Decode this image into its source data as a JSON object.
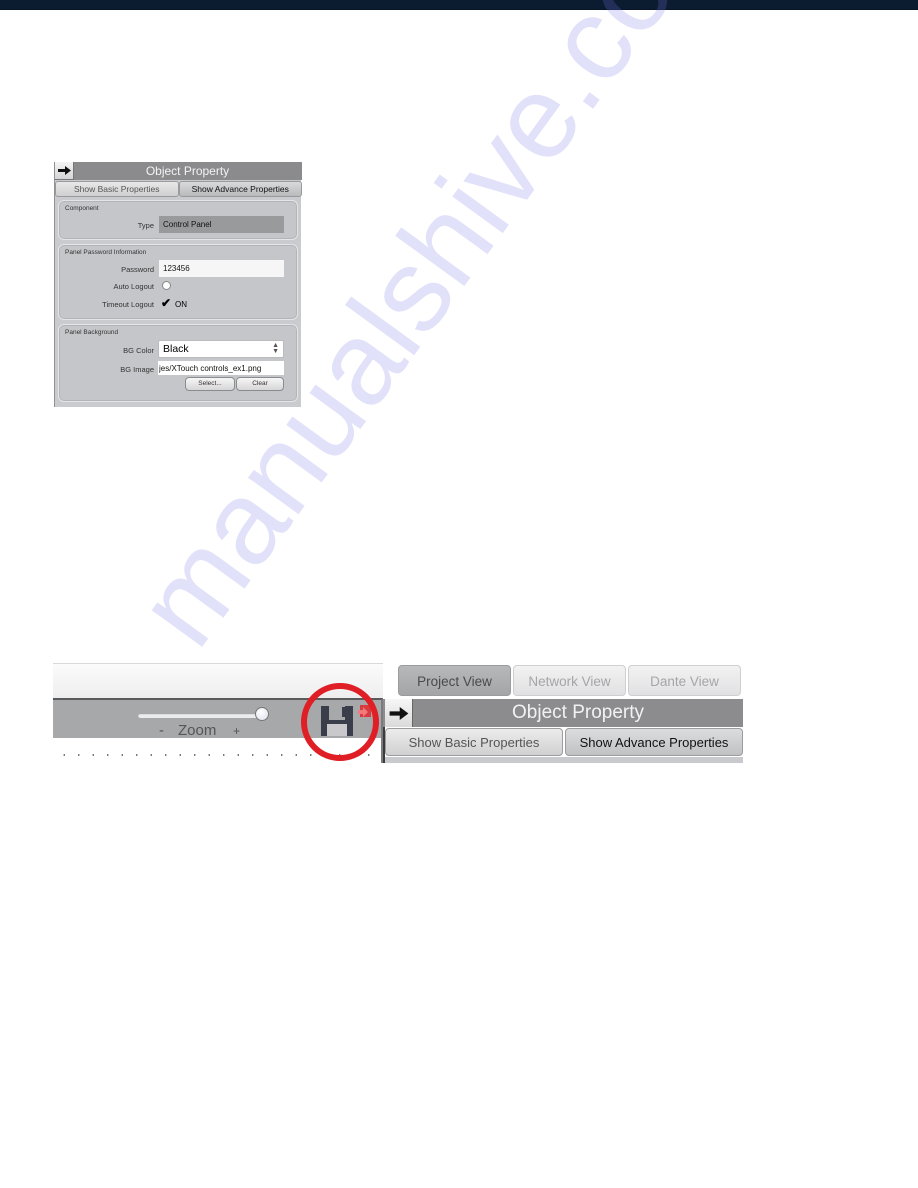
{
  "document": {
    "watermark_text": "manualshive.com"
  },
  "object_property_panel": {
    "title": "Object Property",
    "arrow_icon": "right-arrow-icon",
    "tabs": [
      {
        "label": "Show Basic Properties",
        "active": false
      },
      {
        "label": "Show Advance Properties",
        "active": true
      }
    ],
    "groups": {
      "component": {
        "title": "Component",
        "type_label": "Type",
        "type_value": "Control Panel"
      },
      "password": {
        "title": "Panel Password Information",
        "password_label": "Password",
        "password_value": "123456",
        "auto_logout_label": "Auto Logout",
        "auto_logout_checked": false,
        "timeout_logout_label": "Timeout Logout",
        "timeout_logout_checked": true,
        "timeout_logout_text": "ON",
        "check_glyph": "✔"
      },
      "background": {
        "title": "Panel Background",
        "bg_color_label": "BG Color",
        "bg_color_value": "Black",
        "bg_image_label": "BG Image",
        "bg_image_value": "jes/XTouch controls_ex1.png",
        "select_button": "Select...",
        "clear_button": "Clear"
      }
    }
  },
  "toolbar_crop": {
    "zoom": {
      "minus": "-",
      "label": "Zoom",
      "plus": "+",
      "level_fraction": 1.0
    },
    "save_icon": "floppy-disk-save-icon",
    "export_icon": "red-export-icon",
    "highlight_color": "#e01e25",
    "view_tabs": [
      {
        "label": "Project View",
        "active": true
      },
      {
        "label": "Network View",
        "active": false
      },
      {
        "label": "Dante View",
        "active": false
      }
    ],
    "object_property": {
      "title": "Object Property",
      "tabs": [
        {
          "label": "Show Basic Properties",
          "active": false
        },
        {
          "label": "Show Advance Properties",
          "active": true
        }
      ]
    }
  }
}
